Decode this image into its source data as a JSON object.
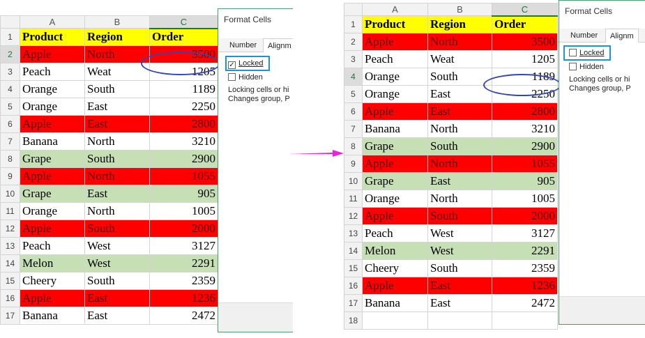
{
  "columns": [
    "A",
    "B",
    "C"
  ],
  "left": {
    "rows": [
      {
        "n": "1",
        "product": "Product",
        "region": "Region",
        "order": "Order",
        "style": "head"
      },
      {
        "n": "2",
        "product": "Apple",
        "region": "North",
        "order": "3500",
        "style": "red"
      },
      {
        "n": "3",
        "product": "Peach",
        "region": "Weat",
        "order": "1205",
        "style": ""
      },
      {
        "n": "4",
        "product": "Orange",
        "region": "South",
        "order": "1189",
        "style": ""
      },
      {
        "n": "5",
        "product": "Orange",
        "region": "East",
        "order": "2250",
        "style": ""
      },
      {
        "n": "6",
        "product": "Apple",
        "region": "East",
        "order": "2800",
        "style": "red"
      },
      {
        "n": "7",
        "product": "Banana",
        "region": "North",
        "order": "3210",
        "style": ""
      },
      {
        "n": "8",
        "product": "Grape",
        "region": "South",
        "order": "2900",
        "style": "green"
      },
      {
        "n": "9",
        "product": "Apple",
        "region": "North",
        "order": "1055",
        "style": "red"
      },
      {
        "n": "10",
        "product": "Grape",
        "region": "East",
        "order": "905",
        "style": "green"
      },
      {
        "n": "11",
        "product": "Orange",
        "region": "North",
        "order": "1005",
        "style": ""
      },
      {
        "n": "12",
        "product": "Apple",
        "region": "South",
        "order": "2000",
        "style": "red"
      },
      {
        "n": "13",
        "product": "Peach",
        "region": "West",
        "order": "3127",
        "style": ""
      },
      {
        "n": "14",
        "product": "Melon",
        "region": "West",
        "order": "2291",
        "style": "green"
      },
      {
        "n": "15",
        "product": "Cheery",
        "region": "South",
        "order": "2359",
        "style": ""
      },
      {
        "n": "16",
        "product": "Apple",
        "region": "East",
        "order": "1236",
        "style": "red"
      },
      {
        "n": "17",
        "product": "Banana",
        "region": "East",
        "order": "2472",
        "style": ""
      }
    ],
    "dialog": {
      "title": "Format Cells",
      "tab_number": "Number",
      "tab_alignment": "Alignm",
      "locked_label": "Locked",
      "locked_checked": true,
      "hidden_label": "Hidden",
      "desc_line1": "Locking cells or hi",
      "desc_line2": "Changes group, P"
    }
  },
  "right": {
    "rows": [
      {
        "n": "1",
        "product": "Product",
        "region": "Region",
        "order": "Order",
        "style": "head"
      },
      {
        "n": "2",
        "product": "Apple",
        "region": "North",
        "order": "3500",
        "style": "red"
      },
      {
        "n": "3",
        "product": "Peach",
        "region": "Weat",
        "order": "1205",
        "style": ""
      },
      {
        "n": "4",
        "product": "Orange",
        "region": "South",
        "order": "1189",
        "style": ""
      },
      {
        "n": "5",
        "product": "Orange",
        "region": "East",
        "order": "2250",
        "style": ""
      },
      {
        "n": "6",
        "product": "Apple",
        "region": "East",
        "order": "2800",
        "style": "red"
      },
      {
        "n": "7",
        "product": "Banana",
        "region": "North",
        "order": "3210",
        "style": ""
      },
      {
        "n": "8",
        "product": "Grape",
        "region": "South",
        "order": "2900",
        "style": "green"
      },
      {
        "n": "9",
        "product": "Apple",
        "region": "North",
        "order": "1055",
        "style": "red"
      },
      {
        "n": "10",
        "product": "Grape",
        "region": "East",
        "order": "905",
        "style": "green"
      },
      {
        "n": "11",
        "product": "Orange",
        "region": "North",
        "order": "1005",
        "style": ""
      },
      {
        "n": "12",
        "product": "Apple",
        "region": "South",
        "order": "2000",
        "style": "red"
      },
      {
        "n": "13",
        "product": "Peach",
        "region": "West",
        "order": "3127",
        "style": ""
      },
      {
        "n": "14",
        "product": "Melon",
        "region": "West",
        "order": "2291",
        "style": "green"
      },
      {
        "n": "15",
        "product": "Cheery",
        "region": "South",
        "order": "2359",
        "style": ""
      },
      {
        "n": "16",
        "product": "Apple",
        "region": "East",
        "order": "1236",
        "style": "red"
      },
      {
        "n": "17",
        "product": "Banana",
        "region": "East",
        "order": "2472",
        "style": ""
      }
    ],
    "extra_row": "18",
    "dialog": {
      "title": "Format Cells",
      "tab_number": "Number",
      "tab_alignment": "Alignm",
      "locked_label": "Locked",
      "locked_checked": false,
      "hidden_label": "Hidden",
      "desc_line1": "Locking cells or hi",
      "desc_line2": "Changes group, P"
    }
  },
  "colors": {
    "header_fill": "#ffff00",
    "red_fill": "#ff0000",
    "green_fill": "#c6dfb4",
    "ellipse": "#3347b3",
    "highlight_box": "#1f93d6",
    "arrow": "#ee22dd"
  },
  "icons": {
    "arrow": "arrow-right-icon",
    "checkbox_checked": "checkmark-icon"
  }
}
